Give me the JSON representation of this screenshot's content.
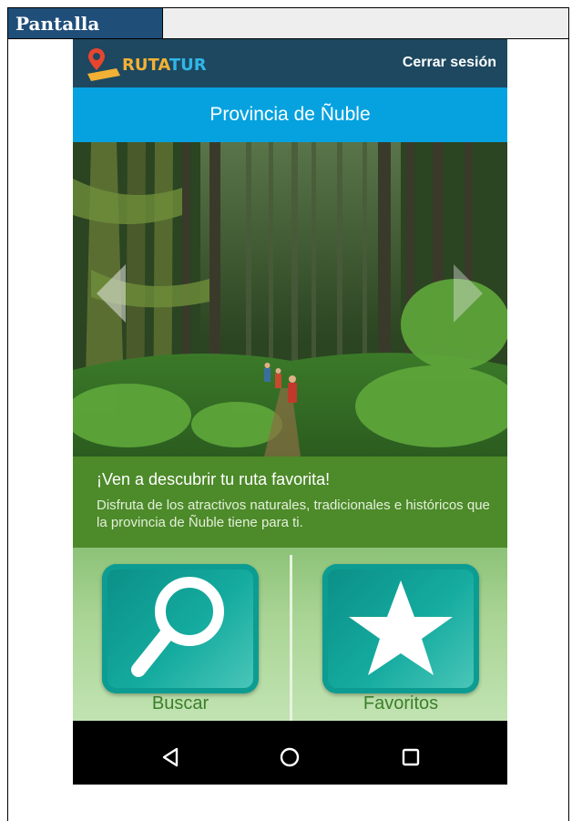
{
  "document": {
    "header_label": "Pantalla"
  },
  "app": {
    "logo_text_part1": "RUTA",
    "logo_text_part2": "TUR",
    "logout_label": "Cerrar sesión",
    "page_title": "Provincia de Ñuble"
  },
  "hero": {
    "alt": "forest-trail-photo",
    "prev_icon": "chevron-left-icon",
    "next_icon": "chevron-right-icon"
  },
  "info": {
    "title": "¡Ven a descubrir tu ruta favorita!",
    "description": "Disfruta de los atractivos naturales, tradicionales e históricos que la provincia de Ñuble tiene para ti."
  },
  "actions": [
    {
      "label": "Buscar",
      "icon": "magnifier-icon"
    },
    {
      "label": "Favoritos",
      "icon": "star-icon"
    }
  ],
  "nav": {
    "back_icon": "back-triangle-icon",
    "home_icon": "home-circle-icon",
    "recents_icon": "recents-square-icon"
  },
  "colors": {
    "app_bar": "#1d4860",
    "title_bar": "#06a2e0",
    "info_panel": "#4d8a2a",
    "tile": "#0d9c91",
    "action_label": "#3c7e2c"
  }
}
